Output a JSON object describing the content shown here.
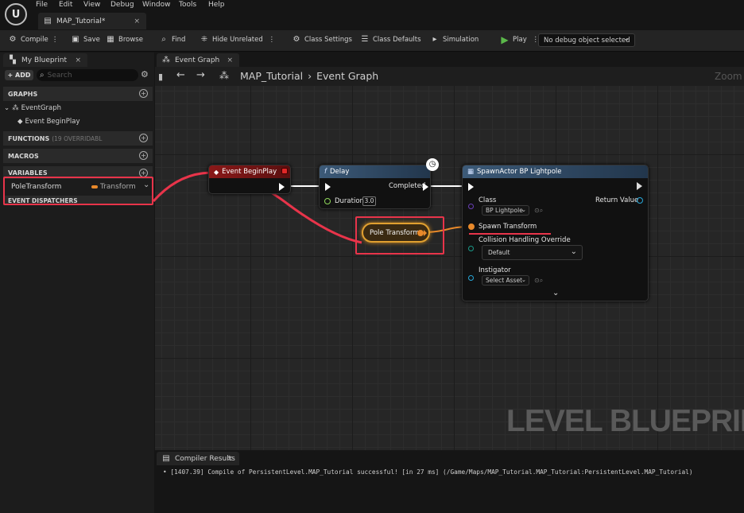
{
  "menu": [
    "File",
    "Edit",
    "View",
    "Debug",
    "Window",
    "Tools",
    "Help"
  ],
  "doc_tab": {
    "title": "MAP_Tutorial*",
    "close": "×"
  },
  "toolbar": {
    "compile": "Compile",
    "save": "Save",
    "browse": "Browse",
    "find": "Find",
    "hide_unrelated": "Hide Unrelated",
    "class_settings": "Class Settings",
    "class_defaults": "Class Defaults",
    "simulation": "Simulation",
    "play": "Play",
    "debug_select": "No debug object selected"
  },
  "left_panel": {
    "tab": "My Blueprint",
    "add": "+ ADD",
    "search_placeholder": "Search",
    "graphs": "GRAPHS",
    "event_graph": "EventGraph",
    "event_begin_play": "Event BeginPlay",
    "functions": "FUNCTIONS",
    "functions_count": "(19 OVERRIDABL",
    "macros": "MACROS",
    "variables": "VARIABLES",
    "variable_name": "PoleTransform",
    "variable_type": "Transform",
    "event_dispatchers": "EVENT DISPATCHERS"
  },
  "graph": {
    "tab": "Event Graph",
    "breadcrumb_root": "MAP_Tutorial",
    "breadcrumb_sep": "›",
    "breadcrumb_leaf": "Event Graph",
    "zoom": "Zoom",
    "watermark": "LEVEL BLUEPRINT"
  },
  "nodes": {
    "begin_play": {
      "title": "Event BeginPlay"
    },
    "delay": {
      "title": "Delay",
      "completed": "Completed",
      "duration_label": "Duration",
      "duration_value": "3.0"
    },
    "pole_transform": {
      "label": "Pole Transform"
    },
    "spawn": {
      "title": "SpawnActor BP Lightpole",
      "class_label": "Class",
      "class_value": "BP Lightpole",
      "return_value": "Return Value",
      "spawn_transform": "Spawn Transform",
      "collision_label": "Collision Handling Override",
      "collision_value": "Default",
      "instigator_label": "Instigator",
      "instigator_value": "Select Asset"
    }
  },
  "results": {
    "tab": "Compiler Results",
    "line": "• [1407.39] Compile of PersistentLevel.MAP_Tutorial successful! [in 27 ms] (/Game/Maps/MAP_Tutorial.MAP_Tutorial:PersistentLevel.MAP_Tutorial)"
  },
  "colors": {
    "highlight": "#e8344a",
    "event_head": "#8a1818",
    "delay_head": "#3c5a78",
    "transform_pin": "#e8892a",
    "exec": "#ffffff",
    "object_pin": "#27a7d9",
    "play": "#5bb84a"
  }
}
